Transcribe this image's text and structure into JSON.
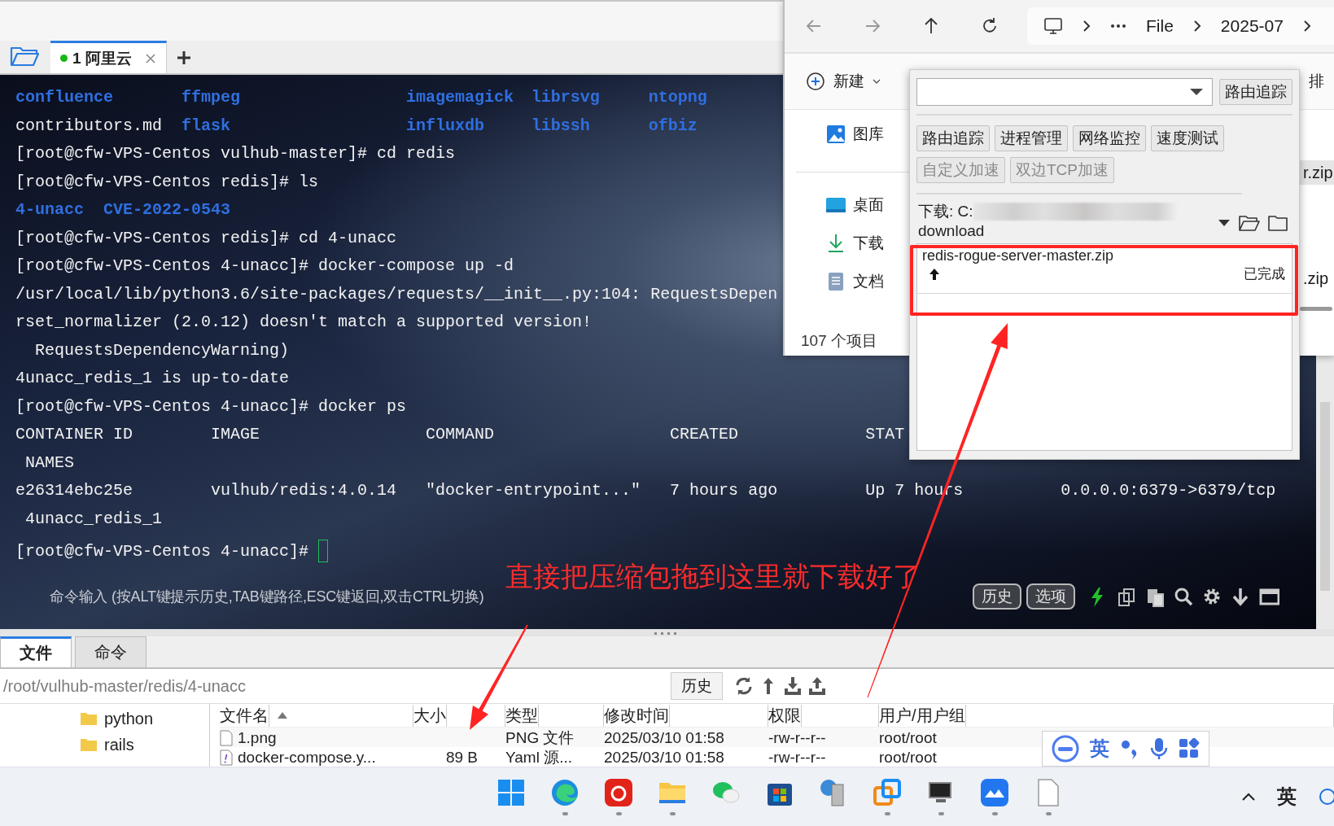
{
  "session_tabs": {
    "tabs": [
      {
        "label": "1 阿里云",
        "selected": true,
        "connected": true
      }
    ]
  },
  "terminal": {
    "lines": [
      {
        "kind": "ls",
        "cells": [
          {
            "text": "confluence",
            "dir": true
          },
          {
            "text": "ffmpeg",
            "dir": true
          },
          {
            "text": "imagemagick",
            "dir": true
          },
          {
            "text": "librsvg",
            "dir": true
          },
          {
            "text": "ntopng",
            "dir": true
          }
        ]
      },
      {
        "kind": "ls",
        "cells": [
          {
            "text": "contributors.md",
            "dir": false
          },
          {
            "text": "flask",
            "dir": true
          },
          {
            "text": "influxdb",
            "dir": true
          },
          {
            "text": "libssh",
            "dir": true
          },
          {
            "text": "ofbiz",
            "dir": true
          }
        ]
      },
      {
        "kind": "text",
        "text": "[root@cfw-VPS-Centos vulhub-master]# cd redis"
      },
      {
        "kind": "text",
        "text": "[root@cfw-VPS-Centos redis]# ls"
      },
      {
        "kind": "list",
        "cells": [
          {
            "text": "4-unacc",
            "dir": true
          },
          {
            "text": "CVE-2022-0543",
            "dir": true
          }
        ]
      },
      {
        "kind": "text",
        "text": "[root@cfw-VPS-Centos redis]# cd 4-unacc"
      },
      {
        "kind": "text",
        "text": "[root@cfw-VPS-Centos 4-unacc]# docker-compose up -d"
      },
      {
        "kind": "text",
        "text": "/usr/local/lib/python3.6/site-packages/requests/__init__.py:104: RequestsDepen"
      },
      {
        "kind": "text",
        "text": "rset_normalizer (2.0.12) doesn't match a supported version!"
      },
      {
        "kind": "text",
        "text": "  RequestsDependencyWarning)"
      },
      {
        "kind": "text",
        "text": "4unacc_redis_1 is up-to-date"
      },
      {
        "kind": "text",
        "text": "[root@cfw-VPS-Centos 4-unacc]# docker ps"
      },
      {
        "kind": "table",
        "cells": [
          {
            "text": "CONTAINER ID"
          },
          {
            "text": "IMAGE"
          },
          {
            "text": "COMMAND"
          },
          {
            "text": "CREATED"
          },
          {
            "text": "STAT"
          }
        ]
      },
      {
        "kind": "text",
        "text": " NAMES"
      },
      {
        "kind": "table",
        "cells": [
          {
            "text": "e26314ebc25e"
          },
          {
            "text": "vulhub/redis:4.0.14"
          },
          {
            "text": "\"docker-entrypoint...\""
          },
          {
            "text": "7 hours ago"
          },
          {
            "text": "Up 7 hours"
          },
          {
            "text": "0.0.0.0:6379->6379/tcp"
          }
        ]
      },
      {
        "kind": "text",
        "text": " 4unacc_redis_1"
      },
      {
        "kind": "prompt",
        "text": "[root@cfw-VPS-Centos 4-unacc]#",
        "cursor": true
      }
    ]
  },
  "command_bar": {
    "hint": "命令输入 (按ALT键提示历史,TAB键路径,ESC键返回,双击CTRL切换)",
    "buttons": [
      "历史",
      "选项"
    ]
  },
  "annotation": {
    "text": "直接把压缩包拖到这里就下载好了"
  },
  "file_pane": {
    "tabs": [
      {
        "label": "文件",
        "selected": true
      },
      {
        "label": "命令",
        "selected": false
      }
    ],
    "path": "/root/vulhub-master/redis/4-unacc",
    "history_button": "历史",
    "tree": [
      "python",
      "rails"
    ],
    "columns": [
      {
        "label": "文件名",
        "sorted": true
      },
      {
        "label": "大小",
        "sorted": false
      },
      {
        "label": "类型",
        "sorted": false
      },
      {
        "label": "修改时间",
        "sorted": false
      },
      {
        "label": "权限",
        "sorted": false
      },
      {
        "label": "用户/用户组",
        "sorted": false
      }
    ],
    "rows": [
      {
        "kind": "image",
        "name": "1.png",
        "type": "PNG 文件",
        "modified": "2025/03/10 01:58",
        "permissions": "-rw-r--r--",
        "owner": "root/root"
      },
      {
        "kind": "yaml",
        "name": "docker-compose.y...",
        "size": "89 B",
        "type": "Yaml 源...",
        "modified": "2025/03/10 01:58",
        "permissions": "-rw-r--r--",
        "owner": "root/root"
      }
    ]
  },
  "explorer": {
    "breadcrumb": [
      "File",
      "2025-07"
    ],
    "new_button": "新建",
    "sort_button": "排",
    "sidebar": [
      {
        "label": "图库",
        "kind": "gallery"
      },
      {
        "label": "桌面",
        "kind": "desktop"
      },
      {
        "label": "下载",
        "kind": "download"
      },
      {
        "label": "文档",
        "kind": "document"
      }
    ],
    "files": [
      {
        "name": "r.zip",
        "selected": true
      },
      {
        "name": ".zip",
        "selected": false
      }
    ],
    "status": "107 个项目"
  },
  "net_tool": {
    "route_button": "路由追踪",
    "tools": [
      {
        "label": "路由追踪",
        "disabled": false
      },
      {
        "label": "进程管理",
        "disabled": false
      },
      {
        "label": "网络监控",
        "disabled": false
      },
      {
        "label": "速度测试",
        "disabled": false
      },
      {
        "label": "自定义加速",
        "disabled": true
      },
      {
        "label": "双边TCP加速",
        "disabled": true
      }
    ],
    "download_path": "下载: C:",
    "download_folder": "download",
    "downloads": [
      {
        "name": "redis-rogue-server-master.zip",
        "status": "已完成"
      }
    ]
  },
  "ime_bar": {
    "language": "英"
  },
  "taskbar": {
    "apps": [
      {
        "kind": "start",
        "running": false
      },
      {
        "kind": "browser",
        "running": true
      },
      {
        "kind": "music",
        "running": true
      },
      {
        "kind": "folder",
        "running": true
      },
      {
        "kind": "chat",
        "running": false
      },
      {
        "kind": "store",
        "running": false
      },
      {
        "kind": "server",
        "running": false
      },
      {
        "kind": "squares",
        "running": true
      },
      {
        "kind": "monitor",
        "running": true
      },
      {
        "kind": "cloud",
        "running": true
      },
      {
        "kind": "document",
        "running": true
      }
    ],
    "ime": "英"
  }
}
